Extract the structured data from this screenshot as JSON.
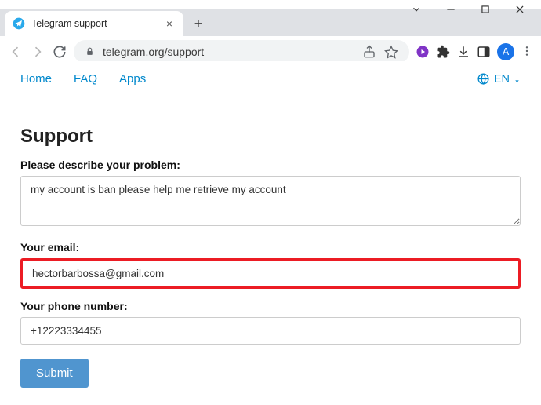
{
  "browser": {
    "tab": {
      "title": "Telegram support"
    },
    "url_text": "telegram.org/support",
    "profile_initial": "A"
  },
  "nav": {
    "home": "Home",
    "faq": "FAQ",
    "apps": "Apps",
    "lang": "EN"
  },
  "page": {
    "heading": "Support",
    "problem_label": "Please describe your problem:",
    "problem_value": "my account is ban please help me retrieve my account",
    "email_label": "Your email:",
    "email_value": "hectorbarbossa@gmail.com",
    "phone_label": "Your phone number:",
    "phone_value": "+12223334455",
    "submit_label": "Submit"
  }
}
